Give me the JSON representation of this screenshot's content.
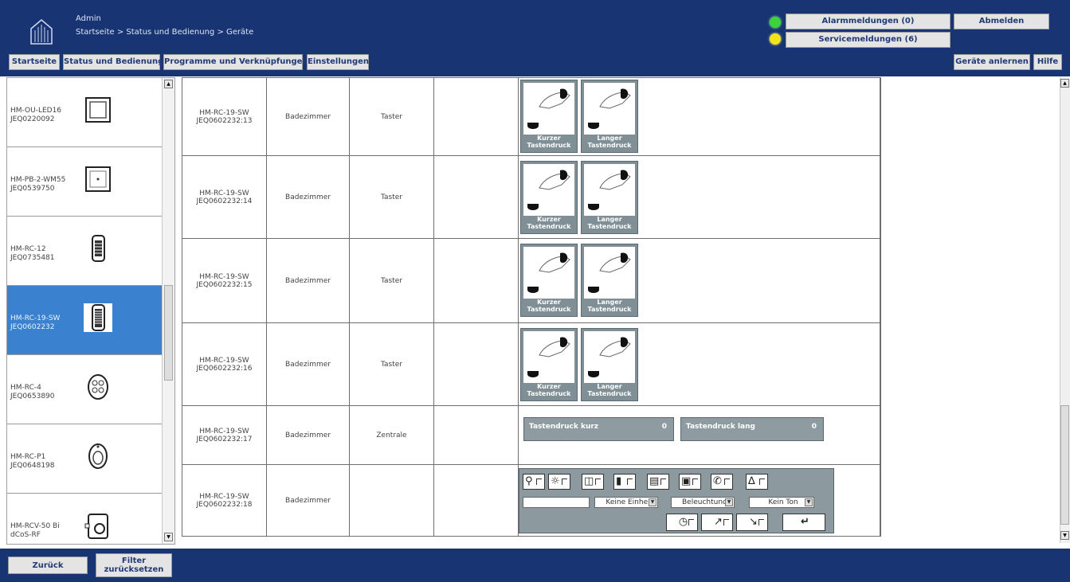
{
  "header": {
    "user": "Admin",
    "breadcrumb": "Startseite > Status und Bedienung > Geräte",
    "alarm_button": "Alarmmeldungen (0)",
    "service_button": "Servicemeldungen (6)",
    "logout_button": "Abmelden",
    "alarm_led_color": "#3bd43b",
    "service_led_color": "#f3e31a"
  },
  "nav": {
    "tabs": [
      "Startseite",
      "Status und Bedienung",
      "Programme und Verknüpfungen",
      "Einstellungen"
    ],
    "teach_button": "Geräte anlernen",
    "help_button": "Hilfe"
  },
  "devices": [
    {
      "name": "HM-OU-LED16",
      "serial": "JEQ0220092",
      "icon": "led-panel-icon",
      "selected": false
    },
    {
      "name": "HM-PB-2-WM55",
      "serial": "JEQ0539750",
      "icon": "wall-button-icon",
      "selected": false
    },
    {
      "name": "HM-RC-12",
      "serial": "JEQ0735481",
      "icon": "remote-control-icon",
      "selected": false
    },
    {
      "name": "HM-RC-19-SW",
      "serial": "JEQ0602232",
      "icon": "remote-control-icon",
      "selected": true
    },
    {
      "name": "HM-RC-4",
      "serial": "JEQ0653890",
      "icon": "keyfob-icon",
      "selected": false
    },
    {
      "name": "HM-RC-P1",
      "serial": "JEQ0648198",
      "icon": "panic-button-icon",
      "selected": false
    },
    {
      "name": "HM-RCV-50 Bi",
      "serial": "dCoS-RF",
      "icon": "virtual-remote-icon",
      "selected": false
    }
  ],
  "channels": [
    {
      "channel": "HM-RC-19-SW",
      "address": "JEQ0602232:13",
      "room": "Badezimmer",
      "function": "Taster"
    },
    {
      "channel": "HM-RC-19-SW",
      "address": "JEQ0602232:14",
      "room": "Badezimmer",
      "function": "Taster"
    },
    {
      "channel": "HM-RC-19-SW",
      "address": "JEQ0602232:15",
      "room": "Badezimmer",
      "function": "Taster"
    },
    {
      "channel": "HM-RC-19-SW",
      "address": "JEQ0602232:16",
      "room": "Badezimmer",
      "function": "Taster"
    },
    {
      "channel": "HM-RC-19-SW",
      "address": "JEQ0602232:17",
      "room": "Badezimmer",
      "function": "Zentrale"
    },
    {
      "channel": "HM-RC-19-SW",
      "address": "JEQ0602232:18",
      "room": "Badezimmer",
      "function": ""
    }
  ],
  "press": {
    "short_line1": "Kurzer",
    "short_line2": "Tastendruck",
    "long_line1": "Langer",
    "long_line2": "Tastendruck"
  },
  "counters": {
    "short_label": "Tastendruck kurz",
    "short_value": "0",
    "long_label": "Tastendruck lang",
    "long_value": "0"
  },
  "display": {
    "text_value": "",
    "unit_select": "Keine Einhei",
    "backlight_select": "Beleuchtunc",
    "sound_select": "Kein Ton"
  },
  "footer": {
    "back_button": "Zurück",
    "reset_line1": "Filter",
    "reset_line2": "zurücksetzen"
  }
}
